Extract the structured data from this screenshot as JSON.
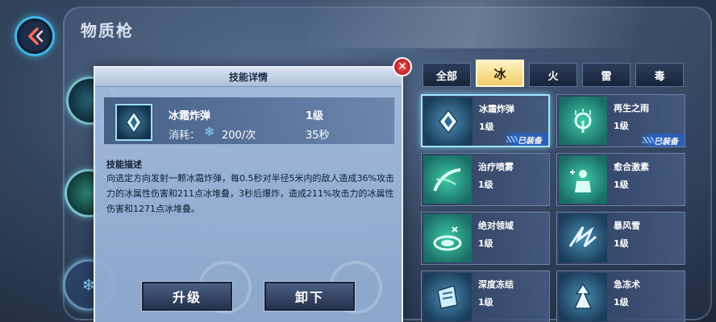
{
  "page_title": "物质枪",
  "detail": {
    "header": "技能详情",
    "close_label": "✕",
    "skill_name": "冰霜炸弹",
    "skill_level": "1级",
    "cost_label": "消耗：",
    "cost_value": "200/次",
    "cooldown": "35秒",
    "desc_title": "技能描述",
    "desc_text": "向选定方向发射一颗冰霜炸弹，每0.5秒对半径5米内的敌人造成36%攻击力的冰属性伤害和211点冰堆叠，3秒后爆炸，造成211%攻击力的冰属性伤害和1271点冰堆叠。",
    "upgrade_label": "升级",
    "unequip_label": "卸下"
  },
  "tabs": [
    {
      "label": "全部",
      "active": false
    },
    {
      "label": "冰",
      "active": true
    },
    {
      "label": "火",
      "active": false
    },
    {
      "label": "雷",
      "active": false
    },
    {
      "label": "毒",
      "active": false
    }
  ],
  "skills": [
    {
      "name": "冰霜炸弹",
      "level": "1级",
      "equipped": "已装备",
      "icon": "frost-bomb-icon"
    },
    {
      "name": "再生之雨",
      "level": "1级",
      "equipped": "已装备",
      "icon": "regen-rain-icon"
    },
    {
      "name": "治疗喷雾",
      "level": "1级",
      "equipped": "",
      "icon": "heal-spray-icon"
    },
    {
      "name": "愈合激素",
      "level": "1级",
      "equipped": "",
      "icon": "heal-hormone-icon"
    },
    {
      "name": "绝对领域",
      "level": "1级",
      "equipped": "",
      "icon": "absolute-field-icon"
    },
    {
      "name": "暴风雪",
      "level": "1级",
      "equipped": "",
      "icon": "blizzard-icon"
    },
    {
      "name": "深度冻结",
      "level": "1级",
      "equipped": "",
      "icon": "deep-freeze-icon"
    },
    {
      "name": "急冻术",
      "level": "1级",
      "equipped": "",
      "icon": "flash-freeze-icon"
    }
  ]
}
